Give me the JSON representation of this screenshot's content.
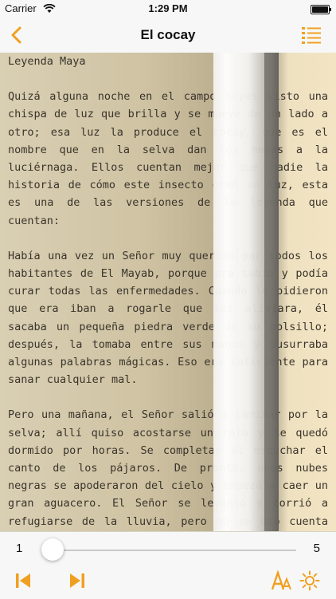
{
  "status_bar": {
    "carrier": "Carrier",
    "time": "1:29 PM"
  },
  "nav": {
    "title": "El cocay"
  },
  "accent_color": "#f0a020",
  "book": {
    "heading": "Leyenda Maya",
    "paragraphs": [
      "Quizá alguna noche en el campo hayas visto una chispa de luz que brilla y se mueve de un lado a otro; esa luz la produce el cocay, que es el nombre que en la selva dan los mayas a la luciérnaga. Ellos cuentan mejor que nadie la historia de cómo este insecto creó su luz, esta es una de las versiones de la leyenda que cuentan:",
      "Había una vez un Señor muy querido por todos los habitantes de El Mayab, porque era sabio y podía curar todas las enfermedades. Cuando le pidieron que era iban a rogarle que los aliviara, él sacaba un pequeña piedra verde de su bolsillo; después, la tomaba entre sus manos y susurraba algunas palabras mágicas. Eso era suficiente para sanar cualquier mal.",
      "Pero una mañana, el Señor salió a caminar por la selva; allí quiso acostarse un rato y se quedó dormido por horas. Se completas al escuchar el canto de los pájaros. De pronto, unas nubes negras se apoderaron del cielo y empezó a caer un gran aguacero. El Señor se levantó y corrió a refugiarse de la lluvia, pero no se dio cuenta que su piedra verde se le había caído del bolsillo. Al llegar a su casa lo esperaba una mujer que le pedía a su hijo, entonces..."
    ]
  },
  "page_slider": {
    "min_label": "1",
    "max_label": "5",
    "current_page": 1,
    "total_pages": 5
  },
  "toolbar": {
    "icons": [
      "first-page-icon",
      "next-page-icon",
      "font-size-icon",
      "brightness-icon"
    ]
  }
}
